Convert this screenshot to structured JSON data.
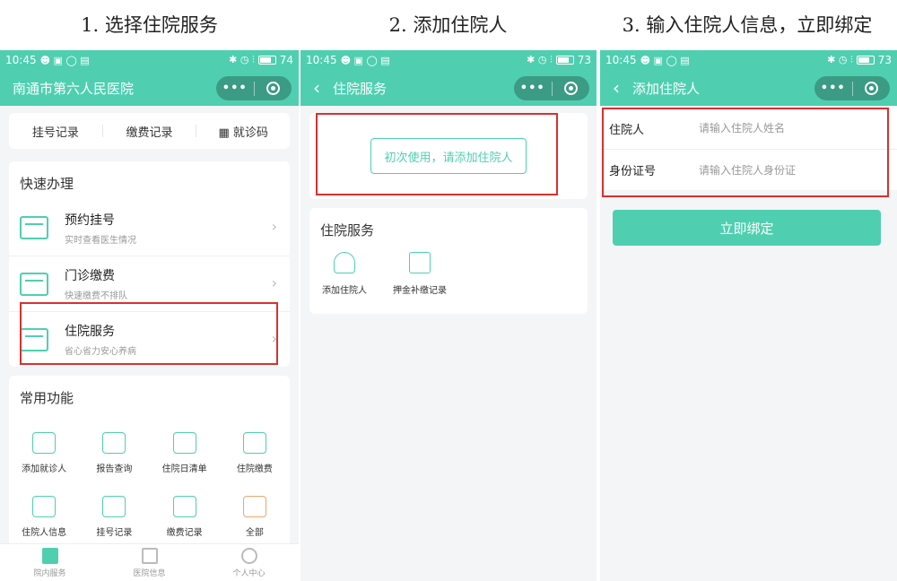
{
  "captions": [
    "1. 选择住院服务",
    "2. 添加住院人",
    "3. 输入住院人信息，立即绑定"
  ],
  "accent_color": "#4fcfb0",
  "highlight_color": "#d9302e",
  "status_bars": [
    {
      "time": "10:45",
      "battery": "74"
    },
    {
      "time": "10:45",
      "battery": "73"
    },
    {
      "time": "10:45",
      "battery": "73"
    }
  ],
  "capsule": {
    "more_icon": "more-dots-icon",
    "close_icon": "record-circle-icon"
  },
  "screen1": {
    "nav_title": "南通市第六人民医院",
    "records": [
      "挂号记录",
      "缴费记录",
      "就诊码"
    ],
    "quick_title": "快速办理",
    "quick_items": [
      {
        "title": "预约挂号",
        "subtitle": "实时查看医生情况",
        "icon": "calendar-icon"
      },
      {
        "title": "门诊缴费",
        "subtitle": "快速缴费不排队",
        "icon": "medical-box-icon"
      },
      {
        "title": "住院服务",
        "subtitle": "省心省力安心养病",
        "icon": "house-heart-icon"
      }
    ],
    "common_title": "常用功能",
    "functions": [
      {
        "label": "添加就诊人",
        "icon": "add-person-icon"
      },
      {
        "label": "报告查询",
        "icon": "report-icon"
      },
      {
        "label": "住院日清单",
        "icon": "daily-list-icon"
      },
      {
        "label": "住院缴费",
        "icon": "house-pay-icon"
      },
      {
        "label": "住院人信息",
        "icon": "bed-icon"
      },
      {
        "label": "挂号记录",
        "icon": "calendar-icon"
      },
      {
        "label": "缴费记录",
        "icon": "folder-icon"
      },
      {
        "label": "全部",
        "icon": "grid-icon"
      }
    ],
    "tabs": [
      {
        "label": "院内服务",
        "active": true
      },
      {
        "label": "医院信息",
        "active": false
      },
      {
        "label": "个人中心",
        "active": false
      }
    ]
  },
  "screen2": {
    "nav_title": "住院服务",
    "add_button": "初次使用，请添加住院人",
    "service_title": "住院服务",
    "services": [
      {
        "label": "添加住院人",
        "icon": "add-person-icon"
      },
      {
        "label": "押金补缴记录",
        "icon": "deposit-doc-icon"
      }
    ]
  },
  "screen3": {
    "nav_title": "添加住院人",
    "fields": [
      {
        "label": "住院人",
        "placeholder": "请输入住院人姓名",
        "value": ""
      },
      {
        "label": "身份证号",
        "placeholder": "请输入住院人身份证",
        "value": ""
      }
    ],
    "bind_button": "立即绑定"
  }
}
